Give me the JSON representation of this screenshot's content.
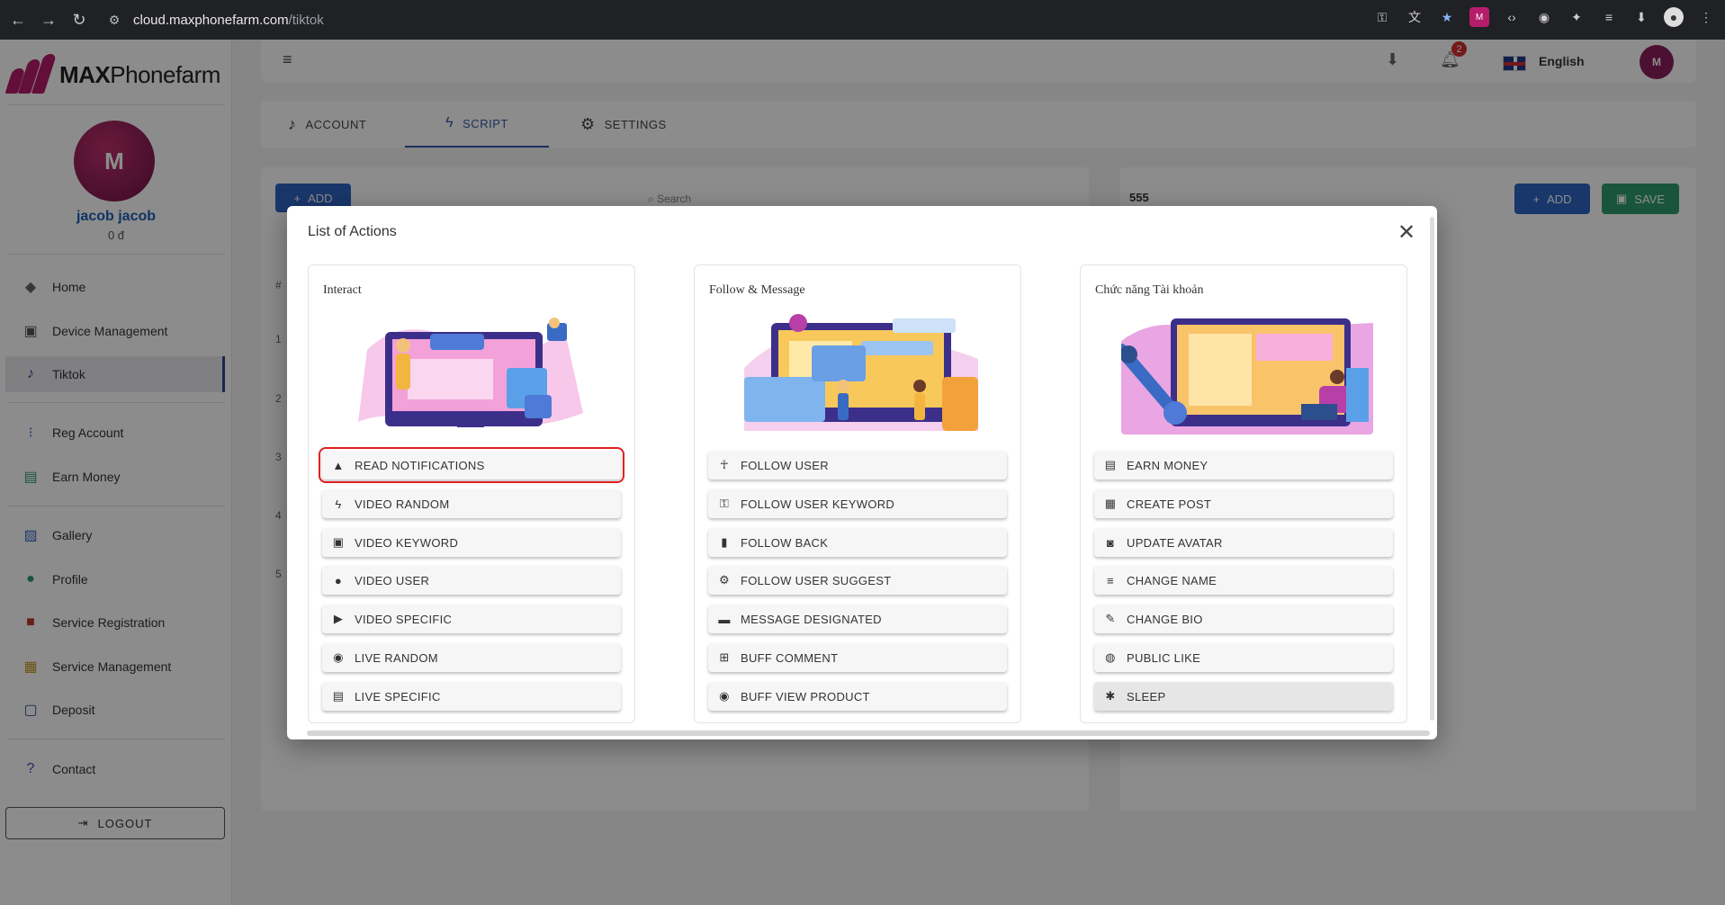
{
  "browser": {
    "url_host": "cloud.maxphonefarm.com",
    "url_path": "/tiktok"
  },
  "sidebar": {
    "logo_bold": "MAX",
    "logo_light": "Phonefarm",
    "user_name": "jacob jacob",
    "user_sub": "0 đ",
    "items": [
      {
        "label": "Home",
        "icon": "layers-icon"
      },
      {
        "label": "Device Management",
        "icon": "device-icon"
      },
      {
        "label": "Tiktok",
        "icon": "tiktok-icon"
      },
      {
        "label": "Reg Account",
        "icon": "reg-icon"
      },
      {
        "label": "Earn Money",
        "icon": "money-icon"
      },
      {
        "label": "Gallery",
        "icon": "gallery-icon"
      },
      {
        "label": "Profile",
        "icon": "profile-icon"
      },
      {
        "label": "Service Registration",
        "icon": "service-icon"
      },
      {
        "label": "Service Management",
        "icon": "management-icon"
      },
      {
        "label": "Deposit",
        "icon": "deposit-icon"
      },
      {
        "label": "Contact",
        "icon": "help-icon"
      }
    ],
    "logout_label": "LOGOUT"
  },
  "header": {
    "notification_count": "2",
    "language": "English"
  },
  "tabs": [
    {
      "label": "ACCOUNT"
    },
    {
      "label": "SCRIPT"
    },
    {
      "label": "SETTINGS"
    }
  ],
  "background": {
    "add_label": "ADD",
    "search_placeholder": "Search",
    "hash": "#",
    "rows": [
      "1",
      "2",
      "3",
      "4",
      "5"
    ],
    "script_name": "555",
    "add2_label": "ADD",
    "save_label": "SAVE"
  },
  "modal": {
    "title": "List of Actions",
    "groups": [
      {
        "title": "Interact",
        "actions": [
          {
            "label": "READ NOTIFICATIONS",
            "icon": "bell-icon"
          },
          {
            "label": "VIDEO RANDOM",
            "icon": "bolt-icon"
          },
          {
            "label": "VIDEO KEYWORD",
            "icon": "video-icon"
          },
          {
            "label": "VIDEO USER",
            "icon": "user-icon"
          },
          {
            "label": "VIDEO SPECIFIC",
            "icon": "play-icon"
          },
          {
            "label": "LIVE RANDOM",
            "icon": "eye-icon"
          },
          {
            "label": "LIVE SPECIFIC",
            "icon": "post-icon"
          }
        ]
      },
      {
        "title": "Follow & Message",
        "actions": [
          {
            "label": "FOLLOW USER",
            "icon": "follow-icon"
          },
          {
            "label": "FOLLOW USER KEYWORD",
            "icon": "key-icon"
          },
          {
            "label": "FOLLOW BACK",
            "icon": "phone-icon"
          },
          {
            "label": "FOLLOW USER SUGGEST",
            "icon": "gear-icon"
          },
          {
            "label": "MESSAGE DESIGNATED",
            "icon": "message-icon"
          },
          {
            "label": "BUFF COMMENT",
            "icon": "comment-icon"
          },
          {
            "label": "BUFF VIEW PRODUCT",
            "icon": "eye-icon"
          }
        ]
      },
      {
        "title": "Chức năng Tài khoản",
        "actions": [
          {
            "label": "EARN MONEY",
            "icon": "money-icon"
          },
          {
            "label": "CREATE POST",
            "icon": "post-icon"
          },
          {
            "label": "UPDATE AVATAR",
            "icon": "camera-icon"
          },
          {
            "label": "CHANGE NAME",
            "icon": "edit-text-icon"
          },
          {
            "label": "CHANGE BIO",
            "icon": "pencil-icon"
          },
          {
            "label": "PUBLIC LIKE",
            "icon": "globe-icon"
          },
          {
            "label": "SLEEP",
            "icon": "snowflake-icon"
          }
        ]
      }
    ]
  },
  "colors": {
    "brand": "#b51d6a",
    "primary": "#2f64c4",
    "save": "#2e9c6e",
    "highlight": "#e02020"
  }
}
